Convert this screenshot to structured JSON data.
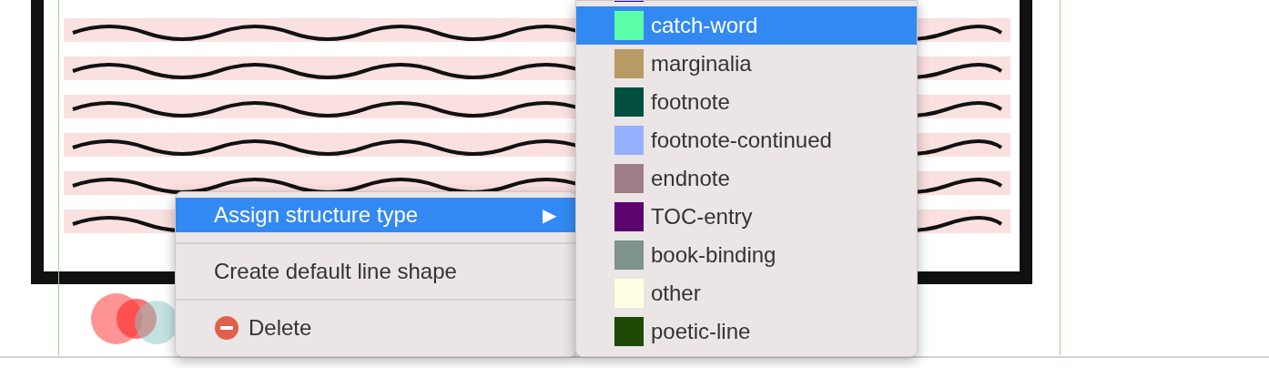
{
  "context_menu": {
    "items": [
      {
        "kind": "submenu",
        "label": "Assign structure type",
        "arrow": "▶",
        "selected": true
      },
      {
        "kind": "separator"
      },
      {
        "kind": "action",
        "label": "Create default line shape",
        "selected": false
      },
      {
        "kind": "separator"
      },
      {
        "kind": "delete",
        "label": "Delete",
        "selected": false
      }
    ]
  },
  "submenu": {
    "items": [
      {
        "color": "#0a0aa8",
        "selected": false
      },
      {
        "label": "catch-word",
        "color": "#5cffa8",
        "selected": true
      },
      {
        "label": "marginalia",
        "color": "#b89a64",
        "selected": false
      },
      {
        "label": "footnote",
        "color": "#024f40",
        "selected": false
      },
      {
        "label": "footnote-continued",
        "color": "#94b0ff",
        "selected": false
      },
      {
        "label": "endnote",
        "color": "#9e7e86",
        "selected": false
      },
      {
        "label": "TOC-entry",
        "color": "#5b0470",
        "selected": false
      },
      {
        "label": "book-binding",
        "color": "#7e928e",
        "selected": false
      },
      {
        "label": "other",
        "color": "#fefee2",
        "selected": false
      },
      {
        "label": "poetic-line",
        "color": "#1d4806",
        "selected": false
      }
    ]
  }
}
